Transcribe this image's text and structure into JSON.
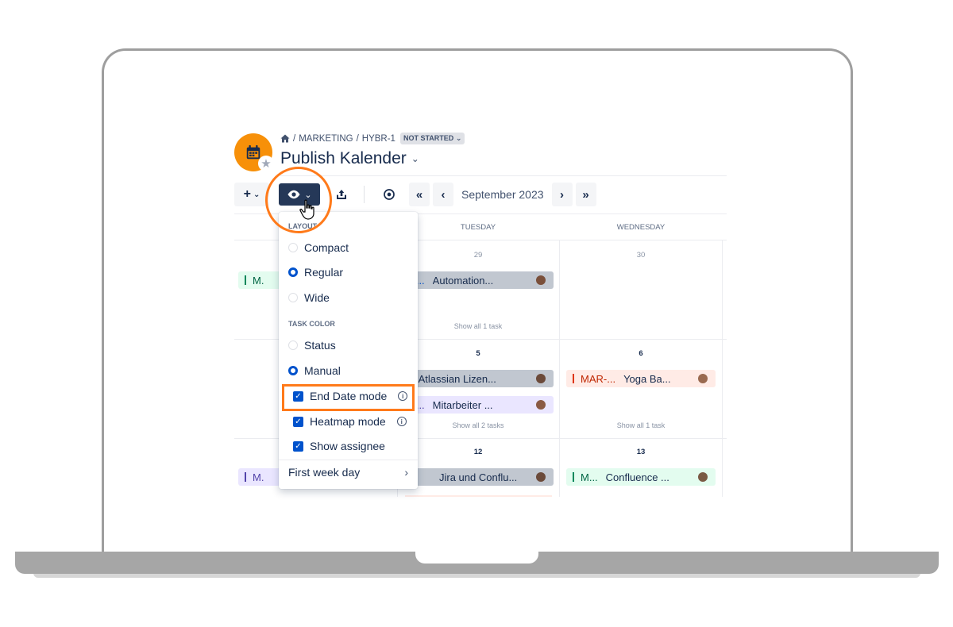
{
  "breadcrumb": {
    "home_icon": "home-icon",
    "project": "MARKETING",
    "issue_key": "HYBR-1",
    "status": "NOT STARTED"
  },
  "page_title": "Publish Kalender",
  "toolbar": {
    "month_label": "September 2023"
  },
  "calendar": {
    "day_headers": [
      "TUESDAY",
      "WEDNESDAY"
    ],
    "dates": [
      "29",
      "30",
      "5",
      "6",
      "12",
      "13"
    ],
    "show_all": {
      "tue_week1": "Show all 1 task",
      "tue_week2": "Show all 2 tasks",
      "wed_week2": "Show all 1 task"
    },
    "tasks": {
      "mon1": {
        "key": "M."
      },
      "tue1": {
        "key": "M...",
        "name": "Automation..."
      },
      "tue2a": {
        "key": "!",
        "name": "Atlassian Lizen..."
      },
      "tue2b": {
        "key": "M...",
        "name": "Mitarbeiter ..."
      },
      "wed2": {
        "key": "MAR-...",
        "name": "Yoga Ba..."
      },
      "mon3": {
        "key": "M."
      },
      "tue3": {
        "name": "Jira und Conflu..."
      },
      "wed3": {
        "key": "M...",
        "name": "Confluence ..."
      }
    }
  },
  "menu": {
    "layout_label": "LAYOUT",
    "compact": "Compact",
    "regular": "Regular",
    "wide": "Wide",
    "task_color_label": "TASK COLOR",
    "status": "Status",
    "manual": "Manual",
    "end_date_mode": "End Date mode",
    "heatmap_mode": "Heatmap mode",
    "show_assignee": "Show assignee",
    "first_week_day": "First week day"
  },
  "colors": {
    "accent_orange": "#ff7a1a",
    "app_icon": "#f79009",
    "primary_blue": "#0052cc",
    "toolbar_dark": "#253858"
  }
}
